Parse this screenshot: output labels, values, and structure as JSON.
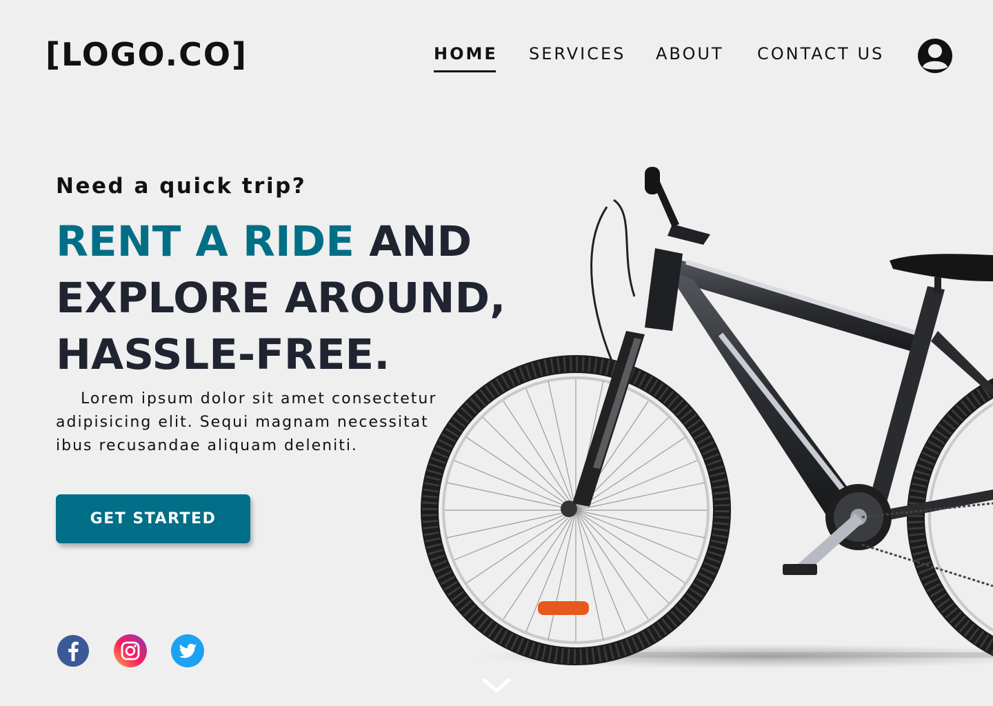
{
  "header": {
    "logo": "[LOGO.CO]",
    "nav": [
      {
        "label": "HOME",
        "active": true
      },
      {
        "label": "SERVICES"
      },
      {
        "label": "ABOUT"
      },
      {
        "label": "CONTACT US"
      }
    ],
    "user_icon": "user-circle-icon"
  },
  "hero": {
    "eyebrow": "Need a quick trip?",
    "headline_accent": "RENT A RIDE",
    "headline_rest_1": " AND",
    "headline_line2": "EXPLORE AROUND,",
    "headline_line3": "HASSLE-FREE.",
    "body": "Lorem ipsum dolor sit amet consectetur adipisicing elit. Sequi magnam necessitat ibus recusandae aliquam deleniti.",
    "cta_label": "GET STARTED"
  },
  "social": [
    "facebook-icon",
    "instagram-icon",
    "twitter-icon"
  ],
  "scroll_icon": "chevron-down-icon",
  "colors": {
    "accent": "#006f86",
    "button": "#016f87",
    "background": "#efefef",
    "text": "#1f2430"
  }
}
